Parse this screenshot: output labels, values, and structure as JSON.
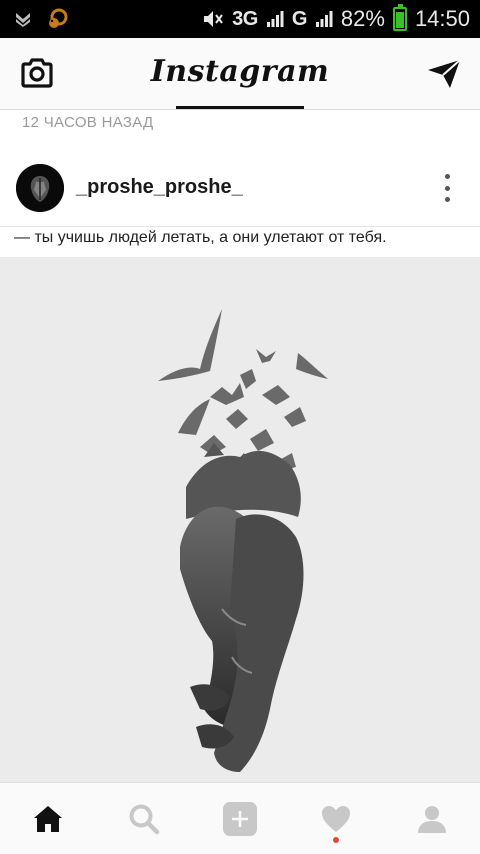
{
  "status_bar": {
    "signal_1": "3G",
    "signal_2": "G",
    "battery_text": "82%",
    "time": "14:50",
    "icons": [
      "notification-icon",
      "squirrel-app-icon",
      "mute-icon",
      "signal-icon",
      "battery-icon"
    ],
    "battery_level": 0.82,
    "battery_color": "#3cbf2a"
  },
  "header": {
    "title": "Instagram",
    "left_icon": "camera-icon",
    "right_icon": "send-icon"
  },
  "feed": {
    "time_ago": "12 ЧАСОВ НАЗАД",
    "post": {
      "username": "_proshe_proshe_",
      "caption": "— ты учишь людей летать, а они улетают от тебя.",
      "image": "hands-dissolving-into-birds"
    }
  },
  "bottom_nav": {
    "items": [
      "home-icon",
      "search-icon",
      "add-icon",
      "activity-heart-icon",
      "profile-icon"
    ],
    "active": "home-icon",
    "notification_dot_color": "#e0483a"
  }
}
